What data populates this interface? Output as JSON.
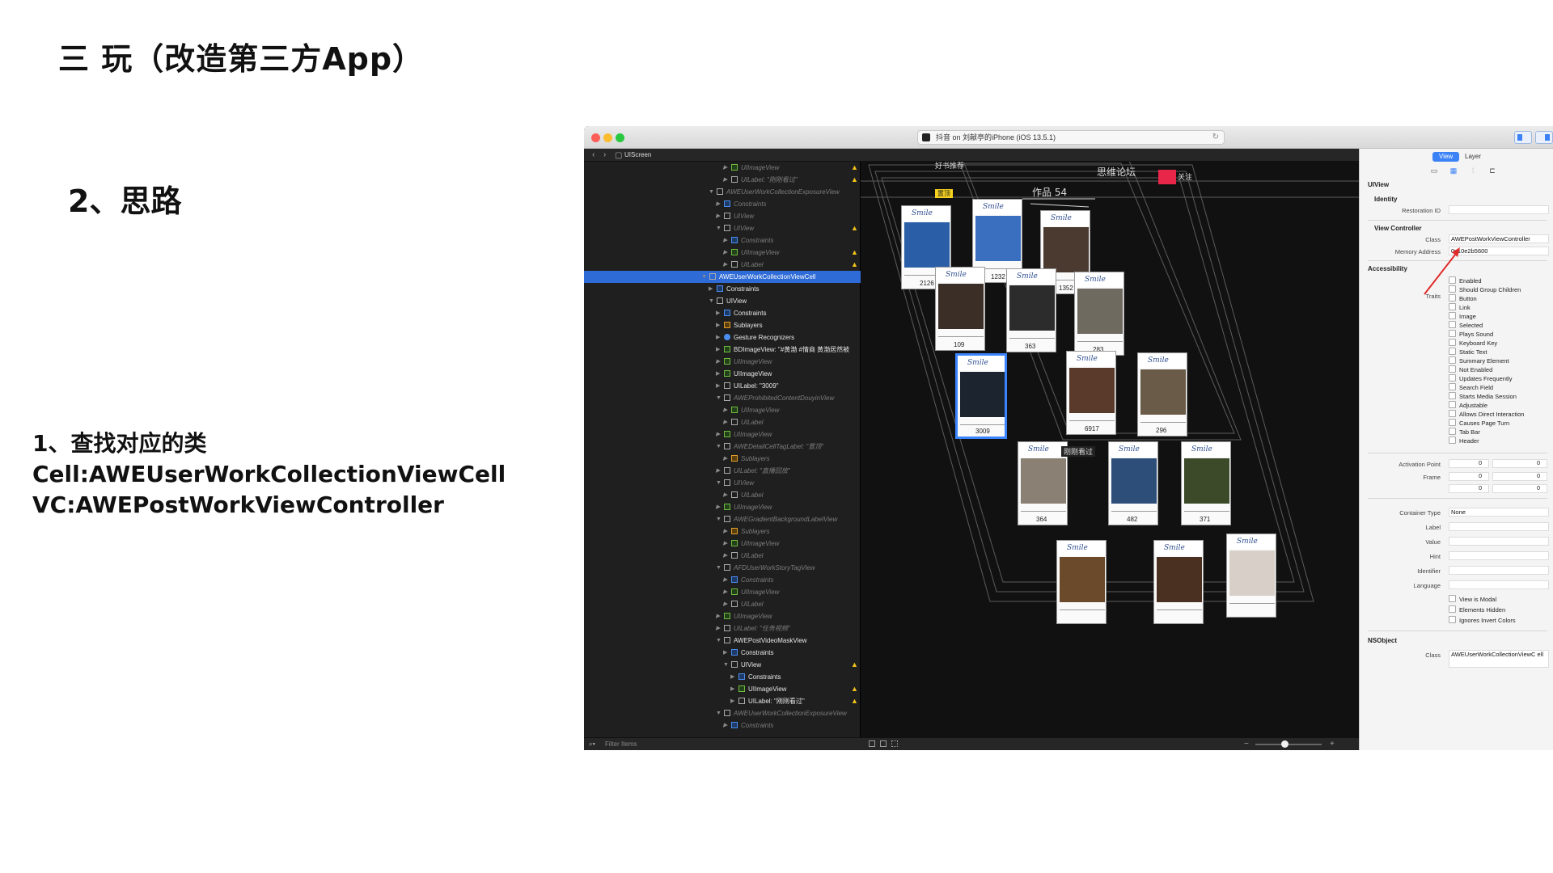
{
  "slide": {
    "title": "三 玩（改造第三方App）",
    "section": "2、思路",
    "notes": [
      "1、查找对应的类",
      "Cell:AWEUserWorkCollectionViewCell",
      "VC:AWEPostWorkViewController"
    ]
  },
  "window": {
    "scheme_title": "抖音 on 刘献亭的iPhone (iOS 13.5.1)",
    "jump_bar": "UIScreen",
    "filter_placeholder": "Filter Items"
  },
  "tree": [
    {
      "label": "UIImageView",
      "level": 4,
      "icon": "green",
      "dim": true,
      "warn": true,
      "open": false
    },
    {
      "label": "UILabel: \"刚刚看过\"",
      "level": 4,
      "icon": "plain",
      "dim": true,
      "warn": true,
      "open": false
    },
    {
      "label": "AWEUserWorkCollectionExposureView",
      "level": 2,
      "icon": "plain",
      "dim": true,
      "warn": false,
      "open": true
    },
    {
      "label": "Constraints",
      "level": 3,
      "icon": "blue",
      "dim": true,
      "warn": false,
      "open": false
    },
    {
      "label": "UIView",
      "level": 3,
      "icon": "plain",
      "dim": true,
      "warn": false,
      "open": false
    },
    {
      "label": "UIView",
      "level": 3,
      "icon": "plain",
      "dim": true,
      "warn": true,
      "open": true
    },
    {
      "label": "Constraints",
      "level": 4,
      "icon": "blue",
      "dim": true,
      "warn": false,
      "open": false
    },
    {
      "label": "UIImageView",
      "level": 4,
      "icon": "green",
      "dim": true,
      "warn": true,
      "open": false
    },
    {
      "label": "UILabel",
      "level": 4,
      "icon": "plain",
      "dim": true,
      "warn": true,
      "open": false
    },
    {
      "label": "AWEUserWorkCollectionViewCell",
      "level": 1,
      "icon": "plain",
      "dim": false,
      "warn": false,
      "open": true,
      "selected": true
    },
    {
      "label": "Constraints",
      "level": 2,
      "icon": "blue",
      "dim": false,
      "warn": false,
      "open": false
    },
    {
      "label": "UIView",
      "level": 2,
      "icon": "plain",
      "dim": false,
      "warn": false,
      "open": true
    },
    {
      "label": "Constraints",
      "level": 3,
      "icon": "blue",
      "dim": false,
      "warn": false,
      "open": false
    },
    {
      "label": "Sublayers",
      "level": 3,
      "icon": "orange",
      "dim": false,
      "warn": false,
      "open": false
    },
    {
      "label": "Gesture Recognizers",
      "level": 3,
      "icon": "dot",
      "dim": false,
      "warn": false,
      "open": false
    },
    {
      "label": "BDImageView: \"#黄渤 #情商 黄渤居然被",
      "level": 3,
      "icon": "green",
      "dim": false,
      "warn": false,
      "open": false
    },
    {
      "label": "UIImageView",
      "level": 3,
      "icon": "green",
      "dim": true,
      "warn": false,
      "open": false
    },
    {
      "label": "UIImageView",
      "level": 3,
      "icon": "green",
      "dim": false,
      "warn": false,
      "open": false
    },
    {
      "label": "UILabel: \"3009\"",
      "level": 3,
      "icon": "plain",
      "dim": false,
      "warn": false,
      "open": false
    },
    {
      "label": "AWEProhibitedContentDouyinView",
      "level": 3,
      "icon": "plain",
      "dim": true,
      "warn": false,
      "open": true
    },
    {
      "label": "UIImageView",
      "level": 4,
      "icon": "green",
      "dim": true,
      "warn": false,
      "open": false
    },
    {
      "label": "UILabel",
      "level": 4,
      "icon": "plain",
      "dim": true,
      "warn": false,
      "open": false
    },
    {
      "label": "UIImageView",
      "level": 3,
      "icon": "green",
      "dim": true,
      "warn": false,
      "open": false
    },
    {
      "label": "AWEDetailCellTagLabel: \"置顶\"",
      "level": 3,
      "icon": "plain",
      "dim": true,
      "warn": false,
      "open": true
    },
    {
      "label": "Sublayers",
      "level": 4,
      "icon": "orange",
      "dim": true,
      "warn": false,
      "open": false
    },
    {
      "label": "UILabel: \"直播回放\"",
      "level": 3,
      "icon": "plain",
      "dim": true,
      "warn": false,
      "open": false
    },
    {
      "label": "UIView",
      "level": 3,
      "icon": "plain",
      "dim": true,
      "warn": false,
      "open": true
    },
    {
      "label": "UILabel",
      "level": 4,
      "icon": "plain",
      "dim": true,
      "warn": false,
      "open": false
    },
    {
      "label": "UIImageView",
      "level": 3,
      "icon": "green",
      "dim": true,
      "warn": false,
      "open": false
    },
    {
      "label": "AWEGradientBackgroundLabelView",
      "level": 3,
      "icon": "plain",
      "dim": true,
      "warn": false,
      "open": true
    },
    {
      "label": "Sublayers",
      "level": 4,
      "icon": "orange",
      "dim": true,
      "warn": false,
      "open": false
    },
    {
      "label": "UIImageView",
      "level": 4,
      "icon": "green",
      "dim": true,
      "warn": false,
      "open": false
    },
    {
      "label": "UILabel",
      "level": 4,
      "icon": "plain",
      "dim": true,
      "warn": false,
      "open": false
    },
    {
      "label": "AFDUserWorkStoryTagView",
      "level": 3,
      "icon": "plain",
      "dim": true,
      "warn": false,
      "open": true
    },
    {
      "label": "Constraints",
      "level": 4,
      "icon": "blue",
      "dim": true,
      "warn": false,
      "open": false
    },
    {
      "label": "UIImageView",
      "level": 4,
      "icon": "green",
      "dim": true,
      "warn": false,
      "open": false
    },
    {
      "label": "UILabel",
      "level": 4,
      "icon": "plain",
      "dim": true,
      "warn": false,
      "open": false
    },
    {
      "label": "UIImageView",
      "level": 3,
      "icon": "green",
      "dim": true,
      "warn": false,
      "open": false
    },
    {
      "label": "UILabel: \"任务视频\"",
      "level": 3,
      "icon": "plain",
      "dim": true,
      "warn": false,
      "open": false
    },
    {
      "label": "AWEPostVideoMaskView",
      "level": 3,
      "icon": "plain",
      "dim": false,
      "warn": false,
      "open": true
    },
    {
      "label": "Constraints",
      "level": 4,
      "icon": "blue",
      "dim": false,
      "warn": false,
      "open": false
    },
    {
      "label": "UIView",
      "level": 4,
      "icon": "plain",
      "dim": false,
      "warn": true,
      "open": true
    },
    {
      "label": "Constraints",
      "level": 5,
      "icon": "blue",
      "dim": false,
      "warn": false,
      "open": false
    },
    {
      "label": "UIImageView",
      "level": 5,
      "icon": "green",
      "dim": false,
      "warn": true,
      "open": false
    },
    {
      "label": "UILabel: \"刚刚看过\"",
      "level": 5,
      "icon": "plain",
      "dim": false,
      "warn": true,
      "open": false
    },
    {
      "label": "AWEUserWorkCollectionExposureView",
      "level": 3,
      "icon": "plain",
      "dim": true,
      "warn": false,
      "open": true
    },
    {
      "label": "Constraints",
      "level": 4,
      "icon": "blue",
      "dim": true,
      "warn": false,
      "open": false
    }
  ],
  "canvas": {
    "header_texts": [
      "思维论坛",
      "作品 54",
      "关注",
      "好书推荐"
    ],
    "top_tag": "置顶",
    "watched_tag": "刚刚看过",
    "cards": [
      {
        "likes": "2126",
        "photo": "#2a5fa8"
      },
      {
        "likes": "1232",
        "photo": "#3a6fc0"
      },
      {
        "likes": "1352",
        "photo": "#4a3a30"
      },
      {
        "likes": "109",
        "photo": "#3a2e26"
      },
      {
        "likes": "363",
        "photo": "#2c2c2c"
      },
      {
        "likes": "283",
        "photo": "#6f6a60"
      },
      {
        "likes": "3009",
        "photo": "#1c2430"
      },
      {
        "likes": "6917",
        "photo": "#5a3a2a"
      },
      {
        "likes": "296",
        "photo": "#6a5a48"
      },
      {
        "likes": "364",
        "photo": "#8a8074"
      },
      {
        "likes": "482",
        "photo": "#2e4e7a"
      },
      {
        "likes": "371",
        "photo": "#3c4a2a"
      },
      {
        "likes": "",
        "photo": "#6a4a2a"
      },
      {
        "likes": "",
        "photo": "#4a3020"
      },
      {
        "likes": "",
        "photo": "#d8d0c8"
      }
    ],
    "card_header": "Smile"
  },
  "inspector": {
    "tabs": [
      "View",
      "Layer"
    ],
    "section_object": "UIView",
    "identity_head": "Identity",
    "restoration_label": "Restoration ID",
    "restoration_value": "",
    "vc_head": "View Controller",
    "class_label": "Class",
    "class_value": "AWEPostWorkViewController",
    "memory_label": "Memory Address",
    "memory_value": "0x10e2b5600",
    "accessibility_head": "Accessibility",
    "traits_label": "Traits",
    "traits": [
      "Enabled",
      "Should Group Children",
      "Button",
      "Link",
      "Image",
      "Selected",
      "Plays Sound",
      "Keyboard Key",
      "Static Text",
      "Summary Element",
      "Not Enabled",
      "Updates Frequently",
      "Search Field",
      "Starts Media Session",
      "Adjustable",
      "Allows Direct Interaction",
      "Causes Page Turn",
      "Tab Bar",
      "Header"
    ],
    "activation_label": "Activation Point",
    "frame_label": "Frame",
    "zero": "0",
    "container_label": "Container Type",
    "container_value": "None",
    "label_label": "Label",
    "value_label": "Value",
    "hint_label": "Hint",
    "identifier_label": "Identifier",
    "language_label": "Language",
    "bottom_checks": [
      "View is Modal",
      "Elements Hidden",
      "Ignores Invert Colors"
    ],
    "nsobject_head": "NSObject",
    "ns_class_label": "Class",
    "ns_class_value": "AWEUserWorkCollectionViewC ell"
  }
}
